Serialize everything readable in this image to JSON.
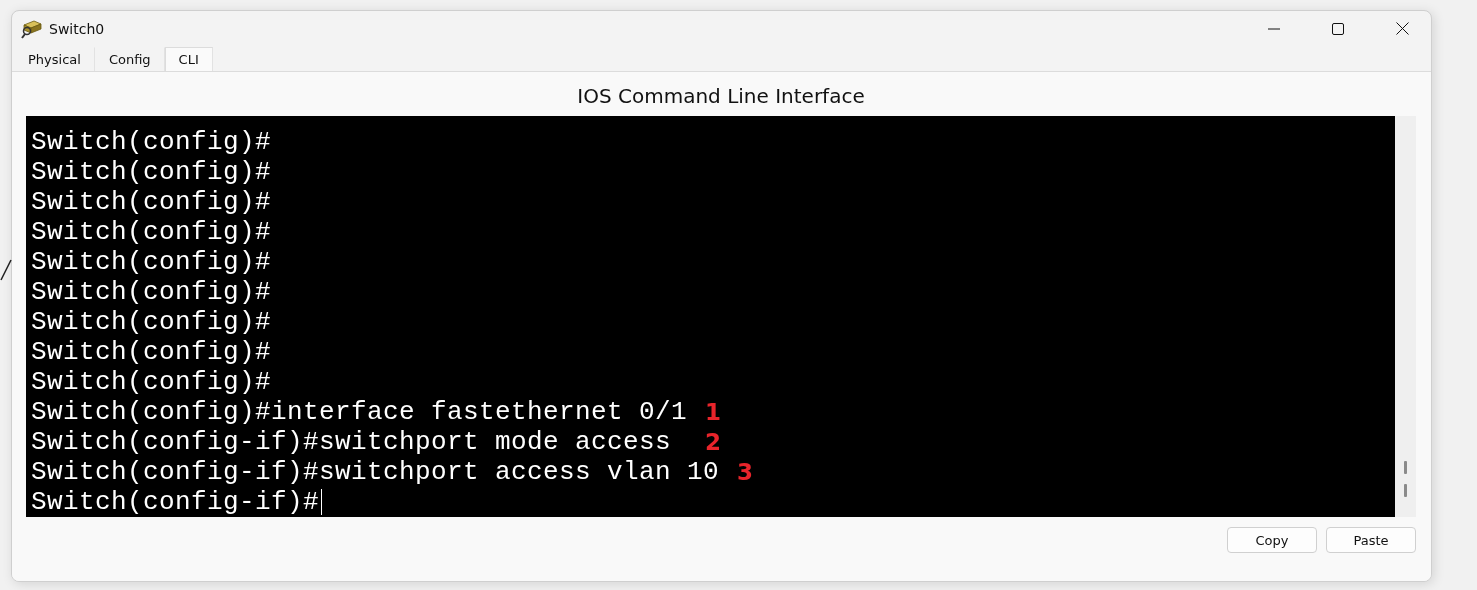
{
  "window": {
    "title": "Switch0"
  },
  "tabs": [
    {
      "label": "Physical",
      "selected": false
    },
    {
      "label": "Config",
      "selected": false
    },
    {
      "label": "CLI",
      "selected": true
    }
  ],
  "heading": "IOS Command Line Interface",
  "terminal": {
    "cursor": true,
    "lines": [
      {
        "text": "Switch(config)#"
      },
      {
        "text": "Switch(config)#"
      },
      {
        "text": "Switch(config)#"
      },
      {
        "text": "Switch(config)#"
      },
      {
        "text": "Switch(config)#"
      },
      {
        "text": "Switch(config)#"
      },
      {
        "text": "Switch(config)#"
      },
      {
        "text": "Switch(config)#"
      },
      {
        "text": "Switch(config)#"
      },
      {
        "text": "Switch(config)#interface fastethernet 0/1",
        "marker": "1"
      },
      {
        "text": "Switch(config-if)#switchport mode access ",
        "marker": "2"
      },
      {
        "text": "Switch(config-if)#switchport access vlan 10",
        "marker": "3"
      },
      {
        "text": "Switch(config-if)#"
      }
    ]
  },
  "buttons": [
    "Copy",
    "Paste"
  ]
}
